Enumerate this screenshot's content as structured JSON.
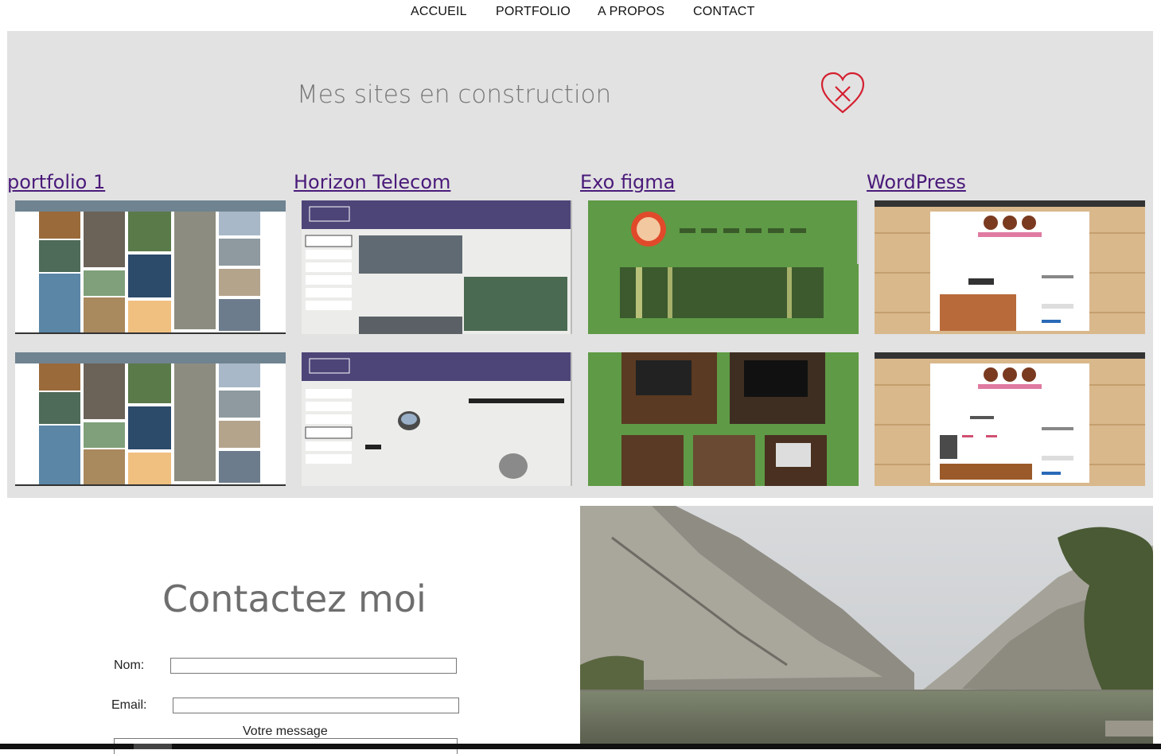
{
  "nav": {
    "items": [
      "ACCUEIL",
      "PORTFOLIO",
      "A PROPOS",
      "CONTACT"
    ]
  },
  "portfolio": {
    "title": "Mes sites en construction",
    "projects": [
      {
        "title": "portfolio 1"
      },
      {
        "title": "Horizon Telecom"
      },
      {
        "title": "Exo figma"
      },
      {
        "title": "WordPress"
      }
    ]
  },
  "contact": {
    "title": "Contactez moi",
    "name_label": "Nom:",
    "email_label": "Email:",
    "message_label": "Votre message"
  },
  "colors": {
    "section_bg": "#e2e2e2",
    "link": "#4a1a7a",
    "heart": "#d42030"
  }
}
